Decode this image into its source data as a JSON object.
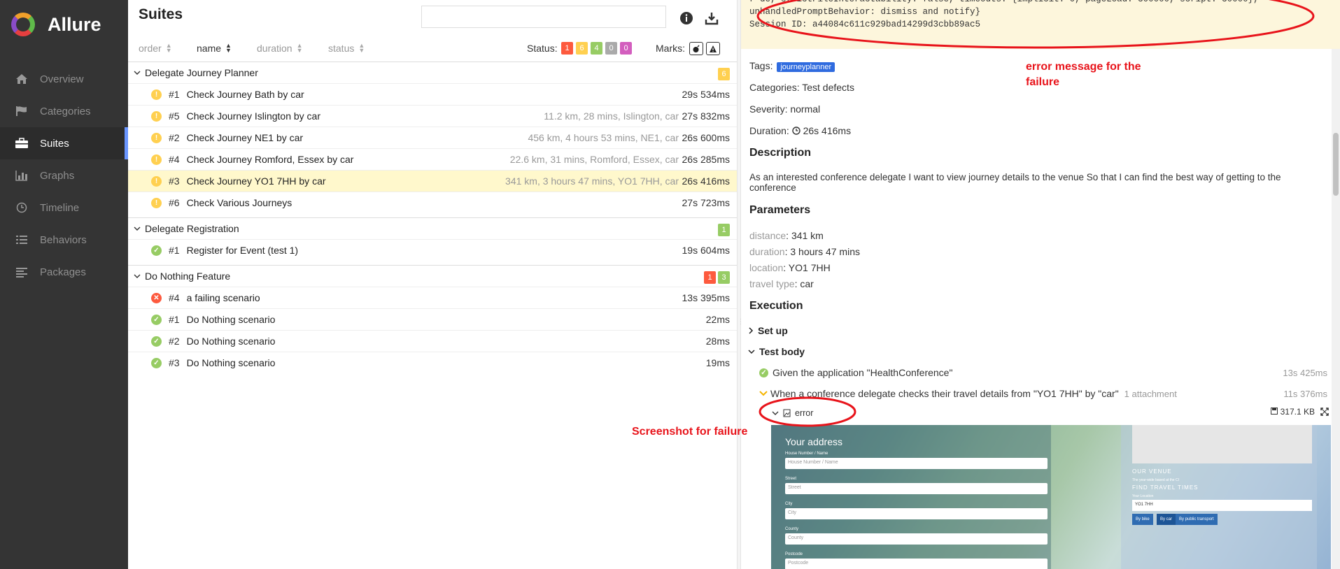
{
  "app": {
    "name": "Allure"
  },
  "sidebar": {
    "items": [
      {
        "label": "Overview",
        "icon": "home-icon"
      },
      {
        "label": "Categories",
        "icon": "flag-icon"
      },
      {
        "label": "Suites",
        "icon": "briefcase-icon",
        "active": true
      },
      {
        "label": "Graphs",
        "icon": "bar-chart-icon"
      },
      {
        "label": "Timeline",
        "icon": "clock-icon"
      },
      {
        "label": "Behaviors",
        "icon": "list-icon"
      },
      {
        "label": "Packages",
        "icon": "align-left-icon"
      }
    ]
  },
  "suites": {
    "title": "Suites",
    "search_placeholder": "",
    "sort": {
      "order": "order",
      "name": "name",
      "duration": "duration",
      "status": "status"
    },
    "status_label": "Status:",
    "status_counts": [
      "1",
      "6",
      "4",
      "0",
      "0"
    ],
    "status_colors": [
      "#fd5a3e",
      "#ffd050",
      "#97cc64",
      "#aaaaaa",
      "#d35ebe"
    ],
    "marks_label": "Marks:",
    "groups": [
      {
        "name": "Delegate Journey Planner",
        "counts": [
          {
            "value": "6",
            "color": "#ffd050"
          }
        ],
        "rows": [
          {
            "status": "broken",
            "num": "#1",
            "name": "Check Journey Bath by car",
            "params": "",
            "duration": "29s 534ms"
          },
          {
            "status": "broken",
            "num": "#5",
            "name": "Check Journey Islington by car",
            "params": "11.2 km, 28 mins, Islington, car",
            "duration": "27s 832ms"
          },
          {
            "status": "broken",
            "num": "#2",
            "name": "Check Journey NE1 by car",
            "params": "456 km, 4 hours 53 mins, NE1, car",
            "duration": "26s 600ms"
          },
          {
            "status": "broken",
            "num": "#4",
            "name": "Check Journey Romford, Essex by car",
            "params": "22.6 km, 31 mins, Romford, Essex, car",
            "duration": "26s 285ms"
          },
          {
            "status": "broken",
            "num": "#3",
            "name": "Check Journey YO1 7HH by car",
            "params": "341 km, 3 hours 47 mins, YO1 7HH, car",
            "duration": "26s 416ms",
            "selected": true
          },
          {
            "status": "broken",
            "num": "#6",
            "name": "Check Various Journeys",
            "params": "",
            "duration": "27s 723ms"
          }
        ]
      },
      {
        "name": "Delegate Registration",
        "counts": [
          {
            "value": "1",
            "color": "#97cc64"
          }
        ],
        "rows": [
          {
            "status": "passed",
            "num": "#1",
            "name": "Register for Event (test 1)",
            "params": "",
            "duration": "19s 604ms"
          }
        ]
      },
      {
        "name": "Do Nothing Feature",
        "counts": [
          {
            "value": "1",
            "color": "#fd5a3e"
          },
          {
            "value": "3",
            "color": "#97cc64"
          }
        ],
        "rows": [
          {
            "status": "failed",
            "num": "#4",
            "name": "a failing scenario",
            "params": "",
            "duration": "13s 395ms"
          },
          {
            "status": "passed",
            "num": "#1",
            "name": "Do Nothing scenario",
            "params": "",
            "duration": "22ms"
          },
          {
            "status": "passed",
            "num": "#2",
            "name": "Do Nothing scenario",
            "params": "",
            "duration": "28ms"
          },
          {
            "status": "passed",
            "num": "#3",
            "name": "Do Nothing scenario",
            "params": "",
            "duration": "19ms"
          }
        ]
      }
    ]
  },
  "detail": {
    "error_lines": [
      "r=de, strictFileInteractability: false, timeouts: {implicit: 0, pageLoad: 300000, script: 30000},",
      "unhandledPromptBehavior: dismiss and notify}",
      "Session ID: a44084c611c929bad14299d3cbb89ac5"
    ],
    "tags_label": "Tags:",
    "tag": "journeyplanner",
    "categories_label": "Categories:",
    "categories_value": "Test defects",
    "severity_label": "Severity:",
    "severity_value": "normal",
    "duration_label": "Duration:",
    "duration_value": "26s 416ms",
    "description_title": "Description",
    "description": "As an interested conference delegate I want to view journey details to the venue So that I can find the best way of getting to the conference",
    "parameters_title": "Parameters",
    "parameters": [
      {
        "key": "distance",
        "value": "341 km"
      },
      {
        "key": "duration",
        "value": "3 hours 47 mins"
      },
      {
        "key": "location",
        "value": "YO1 7HH"
      },
      {
        "key": "travel type",
        "value": "car"
      }
    ],
    "execution_title": "Execution",
    "setup_label": "Set up",
    "testbody_label": "Test body",
    "steps": [
      {
        "text": "Given the application \"HealthConference\"",
        "attachment": "",
        "duration": "13s 425ms",
        "status": "passed"
      },
      {
        "text": "When a conference delegate checks their travel details from \"YO1 7HH\" by \"car\"",
        "attachment": "1 attachment",
        "duration": "11s 376ms",
        "status": "broken"
      }
    ],
    "attachment_name": "error",
    "attachment_size": "317.1 KB"
  },
  "screenshot": {
    "your_address": "Your address",
    "fields": [
      {
        "label": "House Number / Name",
        "placeholder": "House Number / Name"
      },
      {
        "label": "Street",
        "placeholder": "Street"
      },
      {
        "label": "City",
        "placeholder": "City"
      },
      {
        "label": "County",
        "placeholder": "County"
      },
      {
        "label": "Postcode",
        "placeholder": "Postcode"
      }
    ],
    "our_venue": "OUR VENUE",
    "venue_note": "The year-wide based at the CI",
    "find_travel": "FIND TRAVEL TIMES",
    "your_location": "Your Location",
    "location_value": "YO1 7HH",
    "buttons": [
      "By bike",
      "By car",
      "By public transport"
    ]
  },
  "annotations": {
    "error_message": "error message for the failure",
    "screenshot": "Screenshot for failure"
  }
}
